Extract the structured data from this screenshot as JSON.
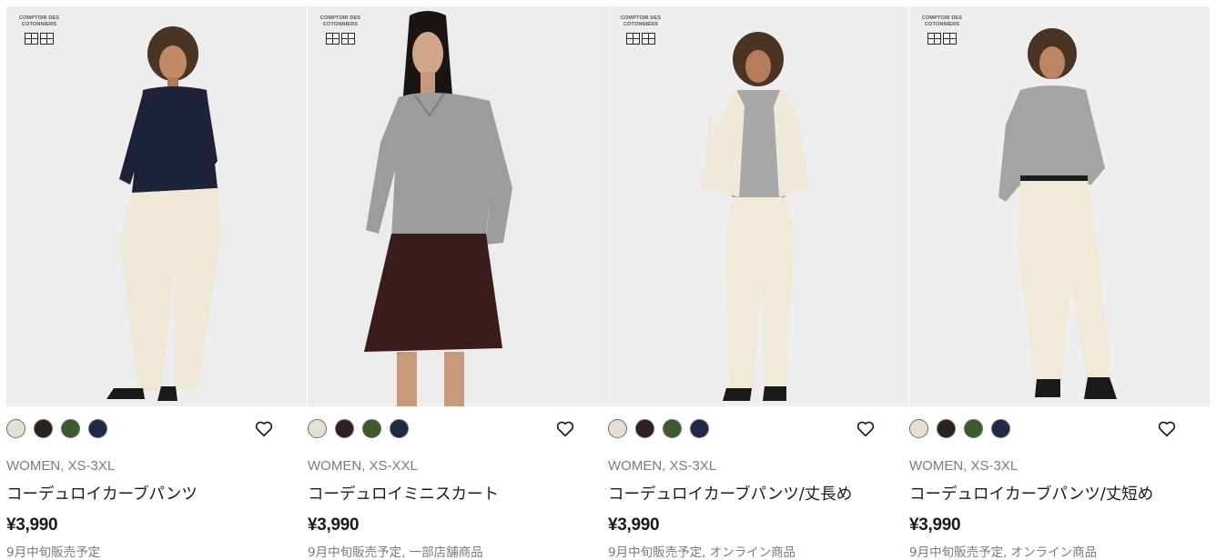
{
  "products": [
    {
      "brand_text": "COMPTOIR DES COTONNIERS",
      "colors": [
        "#e6e0d4",
        "#2e2220",
        "#3f5a2c",
        "#1e2a48"
      ],
      "category": "WOMEN, XS-3XL",
      "name": "コーデュロイカーブパンツ",
      "price": "¥3,990",
      "status": "9月中旬販売予定"
    },
    {
      "brand_text": "COMPTOIR DES COTONNIERS",
      "colors": [
        "#e6e0d4",
        "#2e2220",
        "#3f5a2c",
        "#1e2a48"
      ],
      "category": "WOMEN, XS-XXL",
      "name": "コーデュロイミニスカート",
      "price": "¥3,990",
      "status": "9月中旬販売予定, 一部店舗商品"
    },
    {
      "brand_text": "COMPTOIR DES COTONNIERS",
      "colors": [
        "#e6e0d4",
        "#2e2220",
        "#3f5a2c",
        "#1e2a48"
      ],
      "category": "WOMEN, XS-3XL",
      "name": "コーデュロイカーブパンツ/丈長め",
      "price": "¥3,990",
      "status": "9月中旬販売予定, オンライン商品"
    },
    {
      "brand_text": "COMPTOIR DES COTONNIERS",
      "colors": [
        "#e6e0d4",
        "#2e2220",
        "#3f5a2c",
        "#1e2a48"
      ],
      "category": "WOMEN, XS-3XL",
      "name": "コーデュロイカーブパンツ/丈短め",
      "price": "¥3,990",
      "status": "9月中旬販売予定, オンライン商品"
    }
  ],
  "icons": {
    "favorite": "heart-outline-icon",
    "brand_logo": "uniqlo-logo"
  }
}
